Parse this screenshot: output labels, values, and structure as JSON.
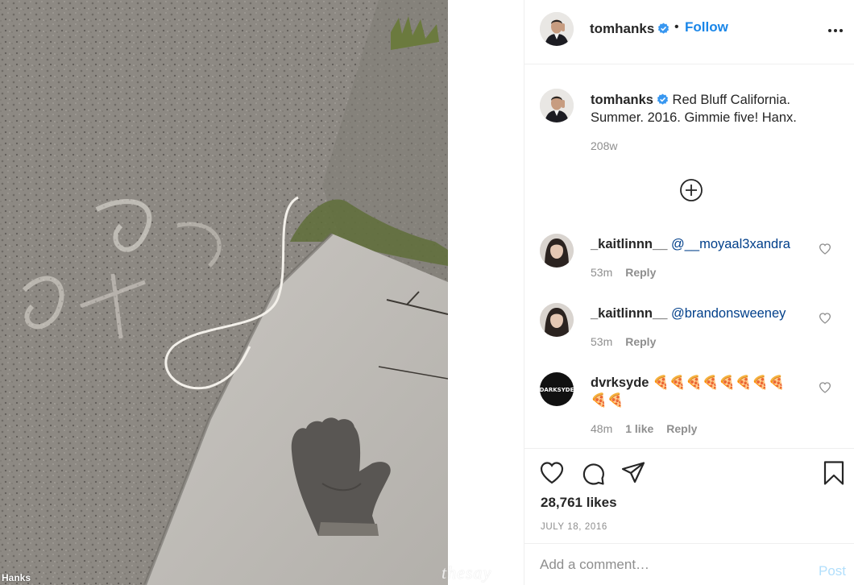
{
  "photo": {
    "alt": "Single work glove lying on a sidewalk next to asphalt with chalk markings",
    "credit": "Hanks",
    "watermark": "thesay"
  },
  "header": {
    "username": "tomhanks",
    "verified": true,
    "separator": "•",
    "follow_label": "Follow",
    "more_icon": "ellipsis-icon"
  },
  "caption": {
    "username": "tomhanks",
    "text": "Red Bluff California. Summer. 2016. Gimmie five! Hanx.",
    "time": "208w"
  },
  "load_more_icon": "plus-circle-icon",
  "comments": [
    {
      "username": "_kaitlinnn__",
      "mention": "@__moyaal3xandra",
      "time": "53m",
      "likes": "",
      "reply_label": "Reply"
    },
    {
      "username": "_kaitlinnn__",
      "mention": "@brandonsweeney",
      "time": "53m",
      "likes": "",
      "reply_label": "Reply"
    },
    {
      "username": "dvrksyde",
      "emoji": "🍕🍕🍕🍕🍕🍕🍕🍕🍕🍕",
      "time": "48m",
      "likes": "1 like",
      "reply_label": "Reply"
    }
  ],
  "actions": {
    "like_icon": "heart-icon",
    "comment_icon": "comment-bubble-icon",
    "share_icon": "paper-plane-icon",
    "save_icon": "bookmark-icon"
  },
  "likes_count": "28,761 likes",
  "post_date": "JULY 18, 2016",
  "add_comment": {
    "placeholder": "Add a comment…",
    "post_label": "Post"
  },
  "colors": {
    "link_blue": "#1a86e8",
    "mention_blue": "#003f8a",
    "muted_text": "#8e8e8e",
    "post_disabled": "#b2dffc"
  }
}
